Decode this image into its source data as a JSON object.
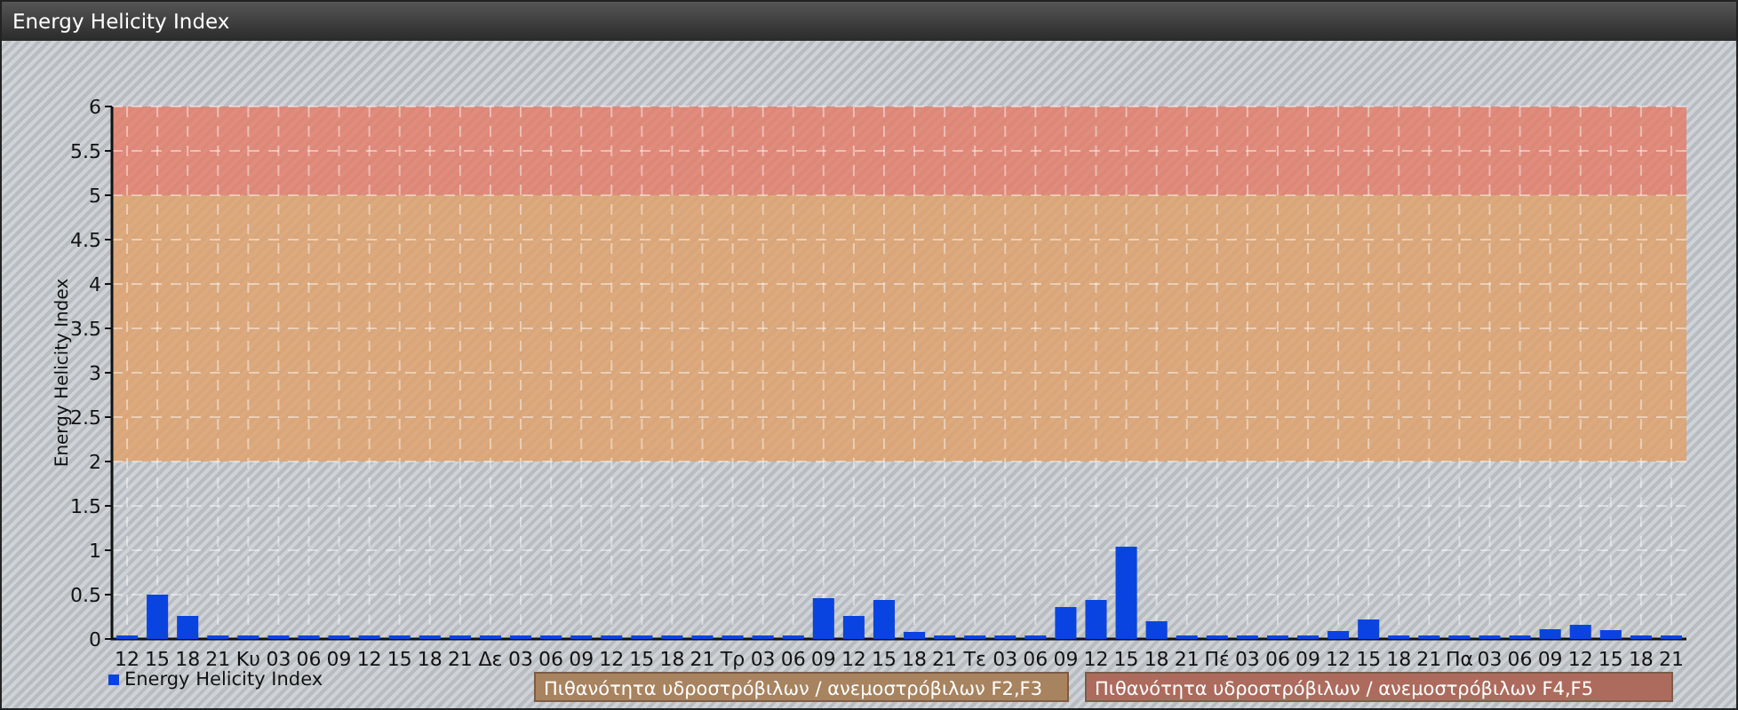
{
  "window": {
    "title": "Energy Helicity Index"
  },
  "chart": {
    "chart_data": {
      "type": "bar",
      "ylabel": "Energy Helicity Index",
      "categories": [
        "12",
        "15",
        "18",
        "21",
        "Κυ",
        "03",
        "06",
        "09",
        "12",
        "15",
        "18",
        "21",
        "Δε",
        "03",
        "06",
        "09",
        "12",
        "15",
        "18",
        "21",
        "Τρ",
        "03",
        "06",
        "09",
        "12",
        "15",
        "18",
        "21",
        "Τε",
        "03",
        "06",
        "09",
        "12",
        "15",
        "18",
        "21",
        "Πέ",
        "03",
        "06",
        "09",
        "12",
        "15",
        "18",
        "21",
        "Πα",
        "03",
        "06",
        "09",
        "12",
        "15",
        "18",
        "21"
      ],
      "series": [
        {
          "name": "Energy Helicity Index",
          "color": "#0a44e0",
          "values": [
            0.02,
            0.48,
            0.24,
            0.02,
            0.02,
            0.02,
            0.02,
            0.02,
            0.02,
            0.02,
            0.02,
            0.02,
            0.02,
            0.02,
            0.02,
            0.02,
            0.02,
            0.02,
            0.02,
            0.02,
            0.02,
            0.02,
            0.02,
            0.44,
            0.24,
            0.42,
            0.06,
            0.02,
            0.02,
            0.02,
            0.02,
            0.34,
            0.42,
            1.02,
            0.18,
            0.02,
            0.02,
            0.02,
            0.02,
            0.02,
            0.07,
            0.2,
            0.02,
            0.02,
            0.02,
            0.02,
            0.02,
            0.09,
            0.14,
            0.08,
            0.02,
            0.02
          ]
        }
      ],
      "ylim": [
        0,
        6
      ],
      "yticks": [
        0,
        0.5,
        1,
        1.5,
        2,
        2.5,
        3,
        3.5,
        4,
        4.5,
        5,
        5.5,
        6
      ],
      "grid": true,
      "bands": [
        {
          "axis": "y",
          "from": 2,
          "to": 5,
          "color": "#e0a068"
        },
        {
          "axis": "y",
          "from": 5,
          "to": 6,
          "color": "#e57b66"
        }
      ]
    },
    "band_legend": [
      {
        "label": "Πιθανότητα υδροστρόβιλων / ανεμοστρόβιλων F2,F3",
        "color": "#a8835f"
      },
      {
        "label": "Πιθανότητα υδροστρόβιλων / ανεμοστρόβιλων F4,F5",
        "color": "#ad6b5d"
      }
    ]
  }
}
